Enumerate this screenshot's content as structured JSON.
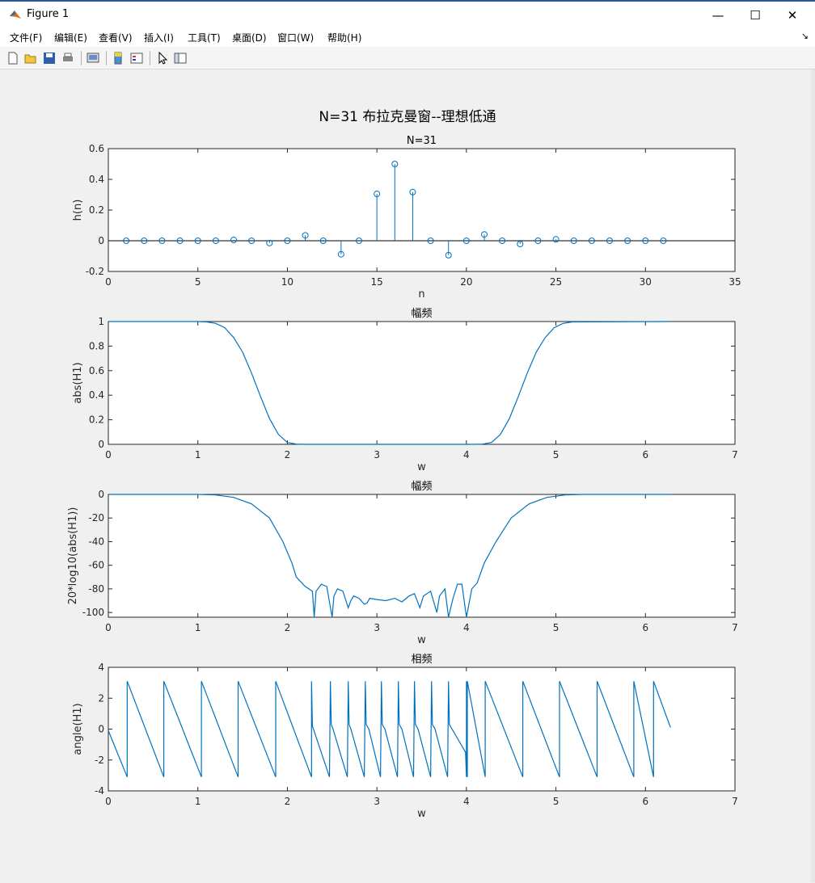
{
  "window": {
    "title": "Figure 1",
    "controls": {
      "minimize": "—",
      "maximize": "☐",
      "close": "✕"
    }
  },
  "menu": [
    "文件(F)",
    "编辑(E)",
    "查看(V)",
    "插入(I)",
    "工具(T)",
    "桌面(D)",
    "窗口(W)",
    "帮助(H)"
  ],
  "toolbar": {
    "icons": [
      "new-figure-icon",
      "open-file-icon",
      "save-icon",
      "print-icon",
      "print-preview-icon",
      "colorbar-icon",
      "legend-icon",
      "pointer-icon",
      "property-editor-icon"
    ]
  },
  "figure": {
    "suptitle": "N=31 布拉克曼窗--理想低通"
  },
  "chart_data": [
    {
      "type": "stem",
      "title": "N=31",
      "xlabel": "n",
      "ylabel": "h(n)",
      "xlim": [
        0,
        35
      ],
      "ylim": [
        -0.2,
        0.6
      ],
      "xticks": [
        "0",
        "5",
        "10",
        "15",
        "20",
        "25",
        "30",
        "35"
      ],
      "yticks": [
        "-0.2",
        "0",
        "0.2",
        "0.4",
        "0.6"
      ],
      "x": [
        1,
        2,
        3,
        4,
        5,
        6,
        7,
        8,
        9,
        10,
        11,
        12,
        13,
        14,
        15,
        16,
        17,
        18,
        19,
        20,
        21,
        22,
        23,
        24,
        25,
        26,
        27,
        28,
        29,
        30,
        31
      ],
      "y": [
        0,
        0,
        0,
        0,
        0,
        0,
        0.005,
        0,
        -0.015,
        0,
        0.035,
        0,
        -0.088,
        0,
        0.305,
        0.5,
        0.317,
        0,
        -0.094,
        0,
        0.041,
        0,
        -0.021,
        0,
        0.009,
        0,
        0,
        0,
        0,
        0,
        0
      ],
      "color": "#0072bd"
    },
    {
      "type": "line",
      "title": "幅频",
      "xlabel": "w",
      "ylabel": "abs(H1)",
      "xlim": [
        0,
        7
      ],
      "ylim": [
        0,
        1
      ],
      "xticks": [
        "0",
        "1",
        "2",
        "3",
        "4",
        "5",
        "6",
        "7"
      ],
      "yticks": [
        "0",
        "0.2",
        "0.4",
        "0.6",
        "0.8",
        "1"
      ],
      "x": [
        0,
        1.0,
        1.1,
        1.2,
        1.3,
        1.4,
        1.5,
        1.6,
        1.7,
        1.8,
        1.9,
        2.0,
        2.1,
        2.2,
        4.08,
        4.18,
        4.28,
        4.38,
        4.48,
        4.58,
        4.68,
        4.78,
        4.88,
        4.98,
        5.08,
        5.18,
        6.28
      ],
      "y": [
        1,
        1,
        0.997,
        0.985,
        0.95,
        0.87,
        0.75,
        0.58,
        0.39,
        0.21,
        0.08,
        0.015,
        0.002,
        0,
        0,
        0.002,
        0.015,
        0.08,
        0.21,
        0.39,
        0.58,
        0.75,
        0.87,
        0.95,
        0.985,
        0.997,
        1
      ],
      "color": "#0072bd"
    },
    {
      "type": "line",
      "title": "幅频",
      "xlabel": "w",
      "ylabel": "20*log10(abs(H1))",
      "xlim": [
        0,
        7
      ],
      "ylim": [
        -104,
        0
      ],
      "xticks": [
        "0",
        "1",
        "2",
        "3",
        "4",
        "5",
        "6",
        "7"
      ],
      "yticks": [
        "-100",
        "-80",
        "-60",
        "-40",
        "-20",
        "0"
      ],
      "x": [
        0,
        1.0,
        1.2,
        1.4,
        1.6,
        1.8,
        1.95,
        2.05,
        2.1,
        2.2,
        2.28,
        2.3,
        2.32,
        2.38,
        2.44,
        2.5,
        2.52,
        2.56,
        2.62,
        2.68,
        2.71,
        2.74,
        2.8,
        2.86,
        2.89,
        2.92,
        3.0,
        3.1,
        3.2,
        3.28,
        3.36,
        3.42,
        3.48,
        3.52,
        3.6,
        3.67,
        3.7,
        3.76,
        3.8,
        3.85,
        3.9,
        3.95,
        4.0,
        4.03,
        4.06,
        4.12,
        4.2,
        4.33,
        4.5,
        4.7,
        4.9,
        5.1,
        5.3,
        6.28
      ],
      "y": [
        0,
        0,
        -0.5,
        -2.5,
        -8,
        -20,
        -40,
        -58,
        -70,
        -78,
        -82,
        -104,
        -82,
        -76,
        -78,
        -104,
        -86,
        -80,
        -82,
        -96,
        -90,
        -86,
        -88,
        -93,
        -92,
        -88,
        -89,
        -90,
        -88,
        -91,
        -86,
        -84,
        -96,
        -86,
        -82,
        -100,
        -86,
        -80,
        -104,
        -88,
        -76,
        -76,
        -104,
        -92,
        -80,
        -75,
        -58,
        -40,
        -20,
        -8,
        -2.5,
        -0.5,
        0,
        0
      ],
      "color": "#0072bd"
    },
    {
      "type": "line",
      "title": "相频",
      "xlabel": "w",
      "ylabel": "angle(H1)",
      "xlim": [
        0,
        7
      ],
      "ylim": [
        -4,
        4
      ],
      "xticks": [
        "0",
        "1",
        "2",
        "3",
        "4",
        "5",
        "6",
        "7"
      ],
      "yticks": [
        "-4",
        "-2",
        "0",
        "2",
        "4"
      ],
      "x": [
        0,
        0.21,
        0.21,
        0.62,
        0.62,
        1.04,
        1.04,
        1.45,
        1.45,
        1.87,
        1.87,
        2.27,
        2.27,
        2.28,
        2.47,
        2.48,
        2.49,
        2.51,
        2.67,
        2.68,
        2.69,
        2.71,
        2.86,
        2.87,
        2.88,
        2.91,
        3.04,
        3.05,
        3.06,
        3.09,
        3.23,
        3.24,
        3.25,
        3.28,
        3.41,
        3.42,
        3.43,
        3.46,
        3.6,
        3.61,
        3.62,
        3.65,
        3.79,
        3.8,
        3.81,
        3.84,
        3.99,
        4.0,
        4.0,
        4.01,
        4.01,
        4.21,
        4.21,
        4.63,
        4.63,
        5.04,
        5.04,
        5.46,
        5.46,
        5.87,
        5.87,
        6.09,
        6.09,
        6.28
      ],
      "y": [
        -0.1,
        -3.1,
        3.1,
        -3.1,
        3.1,
        -3.1,
        3.1,
        -3.1,
        3.1,
        -3.1,
        3.1,
        -3.1,
        3.1,
        0.2,
        -3.1,
        3.1,
        0.3,
        0.0,
        -3.1,
        3.1,
        0.3,
        0.0,
        -3.1,
        3.1,
        0.3,
        0.0,
        -3.1,
        3.1,
        0.3,
        0.0,
        -3.1,
        3.1,
        0.3,
        0.0,
        -3.1,
        3.1,
        0.3,
        0.0,
        -3.1,
        3.1,
        0.3,
        0.0,
        -3.1,
        3.1,
        0.3,
        0.0,
        -1.5,
        -3.1,
        3.1,
        -3.1,
        3.1,
        -3.1,
        3.1,
        -3.1,
        3.1,
        -3.1,
        3.1,
        -3.1,
        3.1,
        -3.1,
        3.1,
        -3.1,
        3.1,
        0.1
      ],
      "color": "#0072bd"
    }
  ]
}
